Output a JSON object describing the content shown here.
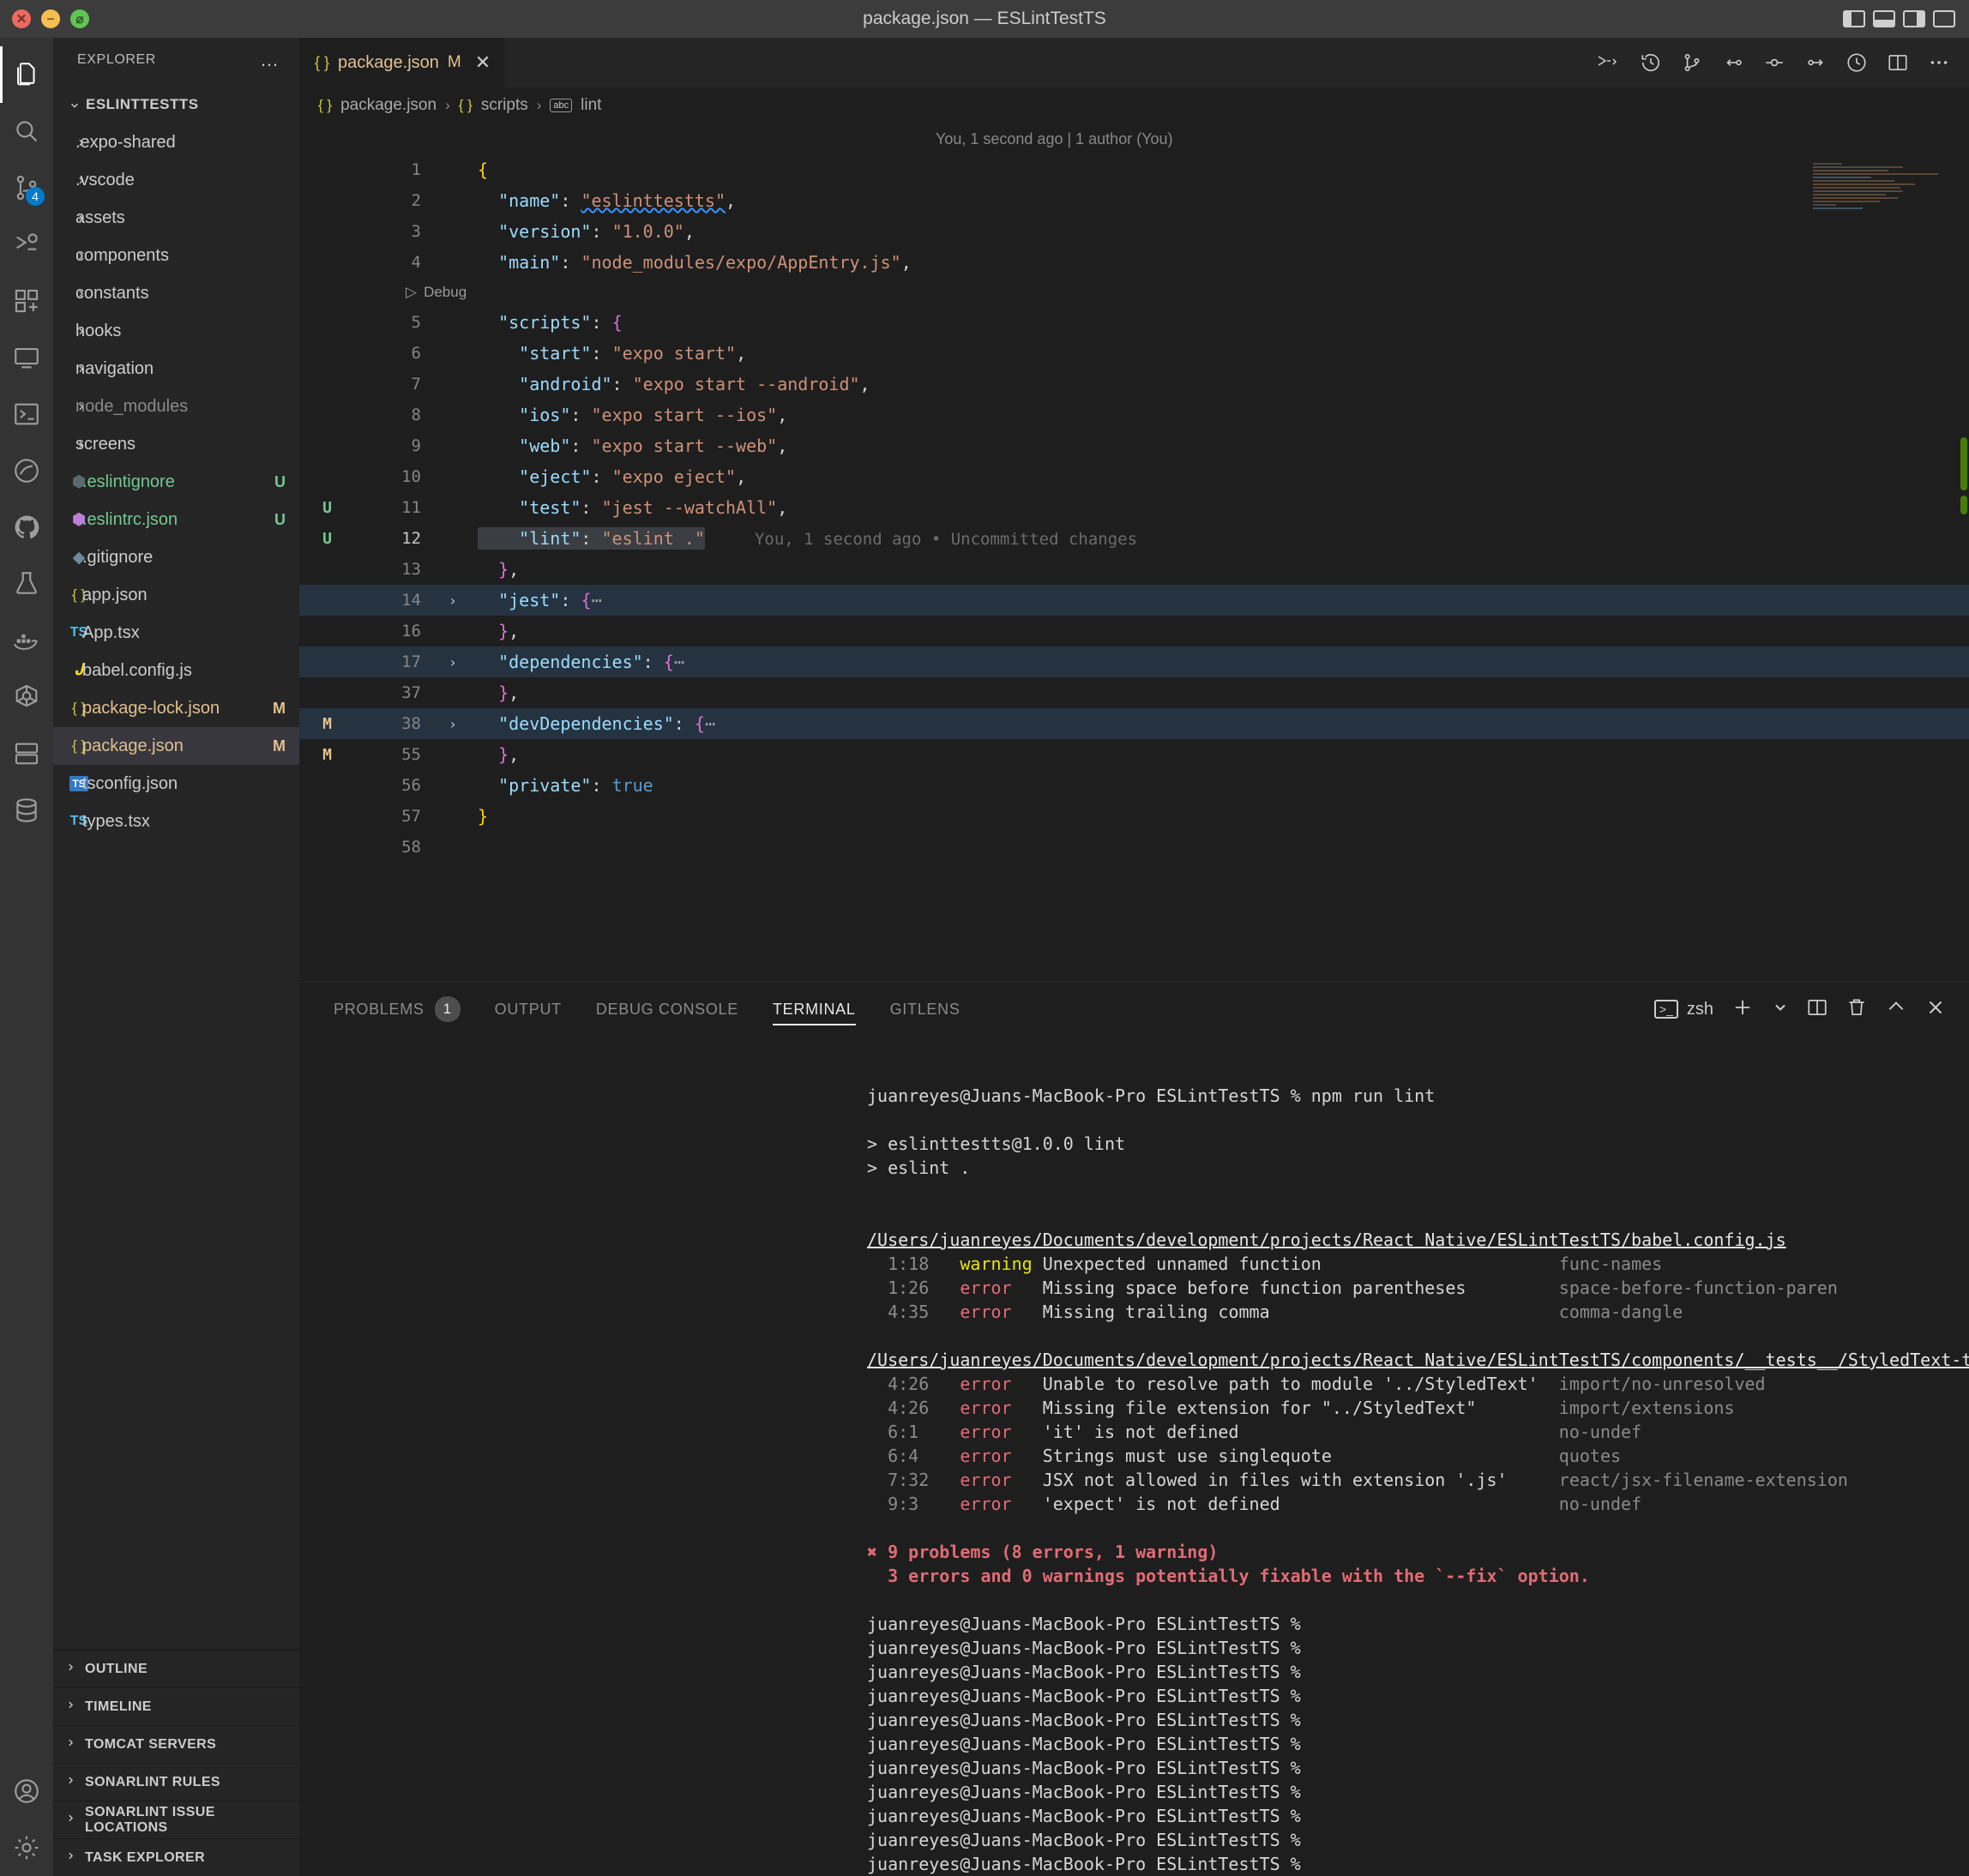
{
  "window": {
    "title": "package.json — ESLintTestTS",
    "traffic": [
      "close",
      "minimize",
      "zoom"
    ],
    "layout_icons": [
      "toggle-primary-sidebar",
      "toggle-panel",
      "toggle-secondary-sidebar",
      "customize-layout"
    ]
  },
  "activitybar": {
    "items": [
      {
        "name": "explorer",
        "icon": "files-icon",
        "active": true,
        "badge": ""
      },
      {
        "name": "search",
        "icon": "search-icon",
        "active": false,
        "badge": ""
      },
      {
        "name": "source-control",
        "icon": "source-control-icon",
        "active": false,
        "badge": "4"
      },
      {
        "name": "run-and-debug",
        "icon": "debug-icon",
        "active": false,
        "badge": ""
      },
      {
        "name": "extensions",
        "icon": "extensions-icon",
        "active": false,
        "badge": ""
      },
      {
        "name": "remote-explorer",
        "icon": "remote-icon",
        "active": false,
        "badge": ""
      },
      {
        "name": "terminal-view",
        "icon": "terminal-icon",
        "active": false,
        "badge": ""
      },
      {
        "name": "sonarlint",
        "icon": "sonar-icon",
        "active": false,
        "badge": ""
      },
      {
        "name": "github",
        "icon": "github-icon",
        "active": false,
        "badge": ""
      },
      {
        "name": "testing",
        "icon": "beaker-icon",
        "active": false,
        "badge": ""
      },
      {
        "name": "docker",
        "icon": "docker-icon",
        "active": false,
        "badge": ""
      },
      {
        "name": "kubernetes",
        "icon": "kubernetes-icon",
        "active": false,
        "badge": ""
      },
      {
        "name": "tomcat",
        "icon": "server-icon",
        "active": false,
        "badge": ""
      },
      {
        "name": "database",
        "icon": "database-icon",
        "active": false,
        "badge": ""
      },
      {
        "name": "accounts",
        "icon": "account-icon",
        "active": false,
        "badge": ""
      },
      {
        "name": "settings",
        "icon": "gear-icon",
        "active": false,
        "badge": ""
      }
    ]
  },
  "sidebar": {
    "header": "EXPLORER",
    "more_actions": "…",
    "root": "ESLINTTESTTS",
    "items": [
      {
        "label": ".expo-shared",
        "kind": "folder",
        "icon": "",
        "status": "",
        "color": ""
      },
      {
        "label": ".vscode",
        "kind": "folder",
        "icon": "",
        "status": "",
        "color": ""
      },
      {
        "label": "assets",
        "kind": "folder",
        "icon": "",
        "status": "",
        "color": ""
      },
      {
        "label": "components",
        "kind": "folder",
        "icon": "",
        "status": "",
        "color": ""
      },
      {
        "label": "constants",
        "kind": "folder",
        "icon": "",
        "status": "",
        "color": ""
      },
      {
        "label": "hooks",
        "kind": "folder",
        "icon": "",
        "status": "",
        "color": ""
      },
      {
        "label": "navigation",
        "kind": "folder",
        "icon": "",
        "status": "",
        "color": ""
      },
      {
        "label": "node_modules",
        "kind": "folder",
        "icon": "",
        "status": "",
        "color": "dim"
      },
      {
        "label": "screens",
        "kind": "folder",
        "icon": "",
        "status": "",
        "color": ""
      },
      {
        "label": ".eslintignore",
        "kind": "file",
        "icon": "eslint-icon-gray",
        "status": "U",
        "color": "grn"
      },
      {
        "label": ".eslintrc.json",
        "kind": "file",
        "icon": "eslint-icon-purple",
        "status": "U",
        "color": "grn"
      },
      {
        "label": ".gitignore",
        "kind": "file",
        "icon": "git-icon",
        "status": "",
        "color": ""
      },
      {
        "label": "app.json",
        "kind": "file",
        "icon": "json-icon",
        "status": "",
        "color": ""
      },
      {
        "label": "App.tsx",
        "kind": "file",
        "icon": "ts-icon",
        "status": "",
        "color": ""
      },
      {
        "label": "babel.config.js",
        "kind": "file",
        "icon": "babel-icon",
        "status": "",
        "color": ""
      },
      {
        "label": "package-lock.json",
        "kind": "file",
        "icon": "json-icon",
        "status": "M",
        "color": "orn"
      },
      {
        "label": "package.json",
        "kind": "file",
        "icon": "json-icon",
        "status": "M",
        "color": "orn",
        "selected": true
      },
      {
        "label": "tsconfig.json",
        "kind": "file",
        "icon": "tsconfig-icon",
        "status": "",
        "color": ""
      },
      {
        "label": "types.tsx",
        "kind": "file",
        "icon": "ts-icon",
        "status": "",
        "color": ""
      }
    ],
    "sections": [
      "OUTLINE",
      "TIMELINE",
      "TOMCAT SERVERS",
      "SONARLINT RULES",
      "SONARLINT ISSUE LOCATIONS",
      "TASK EXPLORER"
    ]
  },
  "editor": {
    "tab": {
      "icon": "json-icon",
      "label": "package.json",
      "dirty_badge": "M",
      "close": "✕"
    },
    "actions": [
      "run-or-debug-icon",
      "timeline-icon",
      "source-control-graph-icon",
      "compare-icon",
      "commit-icon",
      "push-icon",
      "gitlens-icon",
      "split-editor-icon",
      "more-actions-icon"
    ],
    "breadcrumb": [
      {
        "icon": "json-icon",
        "label": "package.json"
      },
      {
        "icon": "json-icon",
        "label": "scripts"
      },
      {
        "icon": "abc-icon",
        "label": "lint"
      }
    ],
    "blame_header": "You, 1 second ago | 1 author (You)",
    "debug_codelens": "Debug",
    "inline_blame": "You, 1 second ago • Uncommitted changes",
    "lines": [
      {
        "num": "1",
        "gstat": "",
        "changed": false,
        "fold": "",
        "indent": 0,
        "tokens": [
          {
            "t": "{",
            "c": "b1"
          }
        ]
      },
      {
        "num": "2",
        "gstat": "",
        "changed": false,
        "fold": "",
        "indent": 1,
        "tokens": [
          {
            "t": "\"name\"",
            "c": "k"
          },
          {
            "t": ": ",
            "c": "p"
          },
          {
            "t": "\"eslinttestts\"",
            "c": "s squiggle"
          },
          {
            "t": ",",
            "c": "p"
          }
        ]
      },
      {
        "num": "3",
        "gstat": "",
        "changed": false,
        "fold": "",
        "indent": 1,
        "tokens": [
          {
            "t": "\"version\"",
            "c": "k"
          },
          {
            "t": ": ",
            "c": "p"
          },
          {
            "t": "\"1.0.0\"",
            "c": "s"
          },
          {
            "t": ",",
            "c": "p"
          }
        ]
      },
      {
        "num": "4",
        "gstat": "",
        "changed": false,
        "fold": "",
        "indent": 1,
        "tokens": [
          {
            "t": "\"main\"",
            "c": "k"
          },
          {
            "t": ": ",
            "c": "p"
          },
          {
            "t": "\"node_modules/expo/AppEntry.js\"",
            "c": "s"
          },
          {
            "t": ",",
            "c": "p"
          }
        ]
      },
      {
        "num": "5",
        "gstat": "",
        "changed": false,
        "fold": "",
        "indent": 1,
        "tokens": [
          {
            "t": "\"scripts\"",
            "c": "k"
          },
          {
            "t": ": ",
            "c": "p"
          },
          {
            "t": "{",
            "c": "b2"
          }
        ]
      },
      {
        "num": "6",
        "gstat": "",
        "changed": false,
        "fold": "",
        "indent": 2,
        "tokens": [
          {
            "t": "\"start\"",
            "c": "k"
          },
          {
            "t": ": ",
            "c": "p"
          },
          {
            "t": "\"expo start\"",
            "c": "s"
          },
          {
            "t": ",",
            "c": "p"
          }
        ]
      },
      {
        "num": "7",
        "gstat": "",
        "changed": false,
        "fold": "",
        "indent": 2,
        "tokens": [
          {
            "t": "\"android\"",
            "c": "k"
          },
          {
            "t": ": ",
            "c": "p"
          },
          {
            "t": "\"expo start --android\"",
            "c": "s"
          },
          {
            "t": ",",
            "c": "p"
          }
        ]
      },
      {
        "num": "8",
        "gstat": "",
        "changed": false,
        "fold": "",
        "indent": 2,
        "tokens": [
          {
            "t": "\"ios\"",
            "c": "k"
          },
          {
            "t": ": ",
            "c": "p"
          },
          {
            "t": "\"expo start --ios\"",
            "c": "s"
          },
          {
            "t": ",",
            "c": "p"
          }
        ]
      },
      {
        "num": "9",
        "gstat": "",
        "changed": false,
        "fold": "",
        "indent": 2,
        "tokens": [
          {
            "t": "\"web\"",
            "c": "k"
          },
          {
            "t": ": ",
            "c": "p"
          },
          {
            "t": "\"expo start --web\"",
            "c": "s"
          },
          {
            "t": ",",
            "c": "p"
          }
        ]
      },
      {
        "num": "10",
        "gstat": "",
        "changed": false,
        "fold": "",
        "indent": 2,
        "tokens": [
          {
            "t": "\"eject\"",
            "c": "k"
          },
          {
            "t": ": ",
            "c": "p"
          },
          {
            "t": "\"expo eject\"",
            "c": "s"
          },
          {
            "t": ",",
            "c": "p"
          }
        ]
      },
      {
        "num": "11",
        "gstat": "U",
        "changed": true,
        "fold": "",
        "indent": 2,
        "tokens": [
          {
            "t": "\"test\"",
            "c": "k"
          },
          {
            "t": ": ",
            "c": "p"
          },
          {
            "t": "\"jest --watchAll\"",
            "c": "s"
          },
          {
            "t": ",",
            "c": "p"
          }
        ]
      },
      {
        "num": "12",
        "gstat": "U",
        "changed": true,
        "fold": "",
        "indent": 2,
        "selected": true,
        "current": true,
        "tokens": [
          {
            "t": "\"lint\"",
            "c": "k"
          },
          {
            "t": ": ",
            "c": "p"
          },
          {
            "t": "\"eslint .\"",
            "c": "s"
          }
        ]
      },
      {
        "num": "13",
        "gstat": "",
        "changed": false,
        "fold": "",
        "indent": 1,
        "tokens": [
          {
            "t": "}",
            "c": "b2"
          },
          {
            "t": ",",
            "c": "p"
          }
        ]
      },
      {
        "num": "14",
        "gstat": "",
        "changed": false,
        "fold": "right",
        "indent": 1,
        "folded": true,
        "tokens": [
          {
            "t": "\"jest\"",
            "c": "k"
          },
          {
            "t": ": ",
            "c": "p"
          },
          {
            "t": "{",
            "c": "b2"
          },
          {
            "t": "⋯",
            "c": "fold-dots"
          }
        ]
      },
      {
        "num": "16",
        "gstat": "",
        "changed": false,
        "fold": "",
        "indent": 1,
        "tokens": [
          {
            "t": "}",
            "c": "b2"
          },
          {
            "t": ",",
            "c": "p"
          }
        ]
      },
      {
        "num": "17",
        "gstat": "",
        "changed": false,
        "fold": "right",
        "indent": 1,
        "folded": true,
        "tokens": [
          {
            "t": "\"dependencies\"",
            "c": "k"
          },
          {
            "t": ": ",
            "c": "p"
          },
          {
            "t": "{",
            "c": "b2"
          },
          {
            "t": "⋯",
            "c": "fold-dots"
          }
        ]
      },
      {
        "num": "37",
        "gstat": "",
        "changed": false,
        "fold": "",
        "indent": 1,
        "tokens": [
          {
            "t": "}",
            "c": "b2"
          },
          {
            "t": ",",
            "c": "p"
          }
        ]
      },
      {
        "num": "38",
        "gstat": "M",
        "changed": false,
        "fold": "right",
        "indent": 1,
        "folded": true,
        "tokens": [
          {
            "t": "\"devDependencies\"",
            "c": "k"
          },
          {
            "t": ": ",
            "c": "p"
          },
          {
            "t": "{",
            "c": "b2"
          },
          {
            "t": "⋯",
            "c": "fold-dots"
          }
        ]
      },
      {
        "num": "55",
        "gstat": "M",
        "changed": false,
        "fold": "",
        "indent": 1,
        "tokens": [
          {
            "t": "}",
            "c": "b2"
          },
          {
            "t": ",",
            "c": "p"
          }
        ]
      },
      {
        "num": "56",
        "gstat": "",
        "changed": false,
        "fold": "",
        "indent": 1,
        "tokens": [
          {
            "t": "\"private\"",
            "c": "k"
          },
          {
            "t": ": ",
            "c": "p"
          },
          {
            "t": "true",
            "c": "bool"
          }
        ]
      },
      {
        "num": "57",
        "gstat": "",
        "changed": false,
        "fold": "",
        "indent": 0,
        "tokens": [
          {
            "t": "}",
            "c": "b1"
          }
        ]
      },
      {
        "num": "58",
        "gstat": "",
        "changed": false,
        "fold": "",
        "indent": 0,
        "tokens": []
      }
    ]
  },
  "panel": {
    "tabs": [
      {
        "label": "PROBLEMS",
        "count": "1",
        "active": false
      },
      {
        "label": "OUTPUT",
        "count": "",
        "active": false
      },
      {
        "label": "DEBUG CONSOLE",
        "count": "",
        "active": false
      },
      {
        "label": "TERMINAL",
        "count": "",
        "active": true
      },
      {
        "label": "GITLENS",
        "count": "",
        "active": false
      }
    ],
    "shell": "zsh",
    "actions": [
      "new-terminal-icon",
      "terminal-dropdown-icon",
      "split-terminal-icon",
      "kill-terminal-icon",
      "maximize-panel-icon",
      "close-panel-icon"
    ],
    "terminal_lines": [
      {
        "type": "blank"
      },
      {
        "type": "prompt",
        "text": "juanreyes@Juans-MacBook-Pro ESLintTestTS % npm run lint"
      },
      {
        "type": "blank"
      },
      {
        "type": "plain",
        "text": "> eslinttestts@1.0.0 lint"
      },
      {
        "type": "plain",
        "text": "> eslint ."
      },
      {
        "type": "blank"
      },
      {
        "type": "blank"
      },
      {
        "type": "path",
        "text": "/Users/juanreyes/Documents/development/projects/React Native/ESLintTestTS/babel.config.js"
      },
      {
        "type": "lint",
        "pos": "1:18",
        "sev": "warning",
        "msg": "Unexpected unnamed function",
        "rule": "func-names"
      },
      {
        "type": "lint",
        "pos": "1:26",
        "sev": "error",
        "msg": "Missing space before function parentheses",
        "rule": "space-before-function-paren"
      },
      {
        "type": "lint",
        "pos": "4:35",
        "sev": "error",
        "msg": "Missing trailing comma",
        "rule": "comma-dangle"
      },
      {
        "type": "blank"
      },
      {
        "type": "path",
        "text": "/Users/juanreyes/Documents/development/projects/React Native/ESLintTestTS/components/__tests__/StyledText-test.js"
      },
      {
        "type": "lint",
        "pos": "4:26",
        "sev": "error",
        "msg": "Unable to resolve path to module '../StyledText'",
        "rule": "import/no-unresolved"
      },
      {
        "type": "lint",
        "pos": "4:26",
        "sev": "error",
        "msg": "Missing file extension for \"../StyledText\"",
        "rule": "import/extensions"
      },
      {
        "type": "lint",
        "pos": "6:1",
        "sev": "error",
        "msg": "'it' is not defined",
        "rule": "no-undef"
      },
      {
        "type": "lint",
        "pos": "6:4",
        "sev": "error",
        "msg": "Strings must use singlequote",
        "rule": "quotes"
      },
      {
        "type": "lint",
        "pos": "7:32",
        "sev": "error",
        "msg": "JSX not allowed in files with extension '.js'",
        "rule": "react/jsx-filename-extension"
      },
      {
        "type": "lint",
        "pos": "9:3",
        "sev": "error",
        "msg": "'expect' is not defined",
        "rule": "no-undef"
      },
      {
        "type": "blank"
      },
      {
        "type": "summary",
        "text": "✖ 9 problems (8 errors, 1 warning)"
      },
      {
        "type": "summary",
        "text": "  3 errors and 0 warnings potentially fixable with the `--fix` option."
      },
      {
        "type": "blank"
      },
      {
        "type": "prompt",
        "text": "juanreyes@Juans-MacBook-Pro ESLintTestTS %"
      },
      {
        "type": "prompt",
        "text": "juanreyes@Juans-MacBook-Pro ESLintTestTS %"
      },
      {
        "type": "prompt",
        "text": "juanreyes@Juans-MacBook-Pro ESLintTestTS %"
      },
      {
        "type": "prompt",
        "text": "juanreyes@Juans-MacBook-Pro ESLintTestTS %"
      },
      {
        "type": "prompt",
        "text": "juanreyes@Juans-MacBook-Pro ESLintTestTS %"
      },
      {
        "type": "prompt",
        "text": "juanreyes@Juans-MacBook-Pro ESLintTestTS %"
      },
      {
        "type": "prompt",
        "text": "juanreyes@Juans-MacBook-Pro ESLintTestTS %"
      },
      {
        "type": "prompt",
        "text": "juanreyes@Juans-MacBook-Pro ESLintTestTS %"
      },
      {
        "type": "prompt",
        "text": "juanreyes@Juans-MacBook-Pro ESLintTestTS %"
      },
      {
        "type": "prompt",
        "text": "juanreyes@Juans-MacBook-Pro ESLintTestTS %"
      },
      {
        "type": "prompt",
        "text": "juanreyes@Juans-MacBook-Pro ESLintTestTS %"
      }
    ]
  },
  "colors": {
    "accent": "#007acc",
    "error": "#e06c75",
    "warning": "#e5e510",
    "modified": "#e2c08d",
    "untracked": "#73c991",
    "string": "#ce9178",
    "key": "#9cdcfe"
  }
}
